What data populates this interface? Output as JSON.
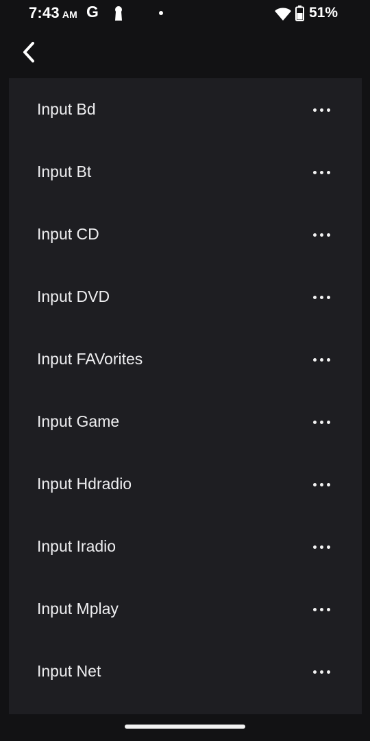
{
  "status_bar": {
    "time": "7:43",
    "ampm": "AM",
    "g_icon_text": "G",
    "icons": [
      "google-icon",
      "keyhole-icon",
      "notification-dot-icon",
      "wifi-icon",
      "battery-icon"
    ],
    "battery_percent": "51%"
  },
  "nav": {
    "back_icon": "chevron-left-icon"
  },
  "inputs": [
    {
      "label": "Input Bd"
    },
    {
      "label": "Input Bt"
    },
    {
      "label": "Input CD"
    },
    {
      "label": "Input DVD"
    },
    {
      "label": "Input FAVorites"
    },
    {
      "label": "Input Game"
    },
    {
      "label": "Input Hdradio"
    },
    {
      "label": "Input Iradio"
    },
    {
      "label": "Input Mplay"
    },
    {
      "label": "Input Net"
    }
  ],
  "item_action_icon": "more-horizontal-icon",
  "colors": {
    "background": "#121214",
    "panel": "#1e1e22",
    "text": "#eeeef0"
  }
}
